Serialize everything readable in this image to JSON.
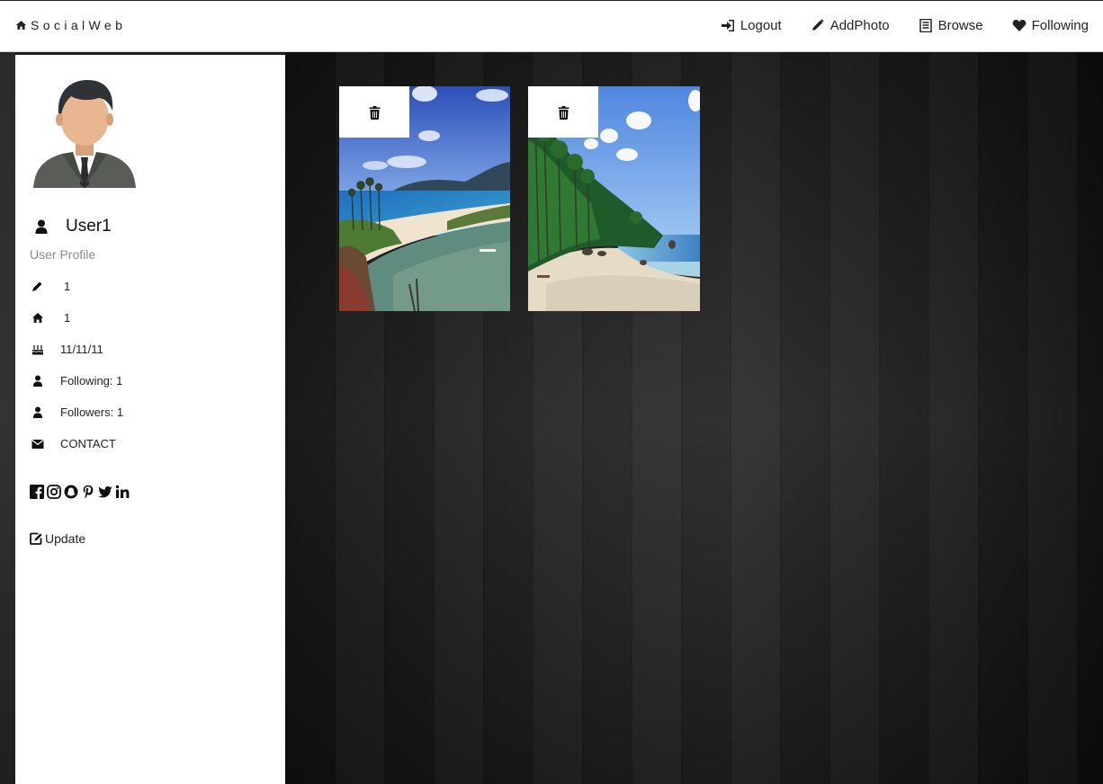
{
  "brand": {
    "name": "SocialWeb",
    "icon": "home-icon"
  },
  "nav": {
    "logout": "Logout",
    "add_photo": "AddPhoto",
    "browse": "Browse",
    "following": "Following"
  },
  "profile": {
    "username": "User1",
    "subtitle": "User Profile",
    "field_pencil": "1",
    "field_home": "1",
    "birthday": "11/11/11",
    "following": "Following: 1",
    "followers": "Followers: 1",
    "contact": "CONTACT",
    "update_label": "Update",
    "socials": [
      "facebook-icon",
      "instagram-icon",
      "snapchat-icon",
      "pinterest-icon",
      "twitter-icon",
      "linkedin-icon"
    ]
  },
  "photos": [
    {
      "scene": "beach-bay",
      "delete_icon": "trash-icon"
    },
    {
      "scene": "palm-beach",
      "delete_icon": "trash-icon"
    }
  ],
  "colors": {
    "accent": "#111111",
    "muted": "#8a8a8a",
    "panel": "#ffffff"
  }
}
